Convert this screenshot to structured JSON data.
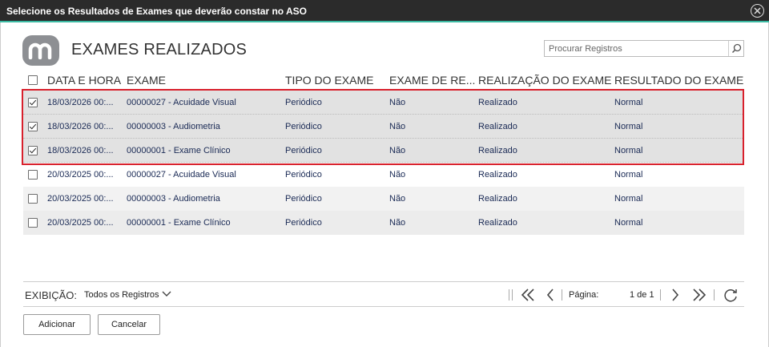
{
  "dialog": {
    "title": "Selecione os Resultados de Exames que deverão constar no ASO"
  },
  "page": {
    "heading": "EXAMES REALIZADOS"
  },
  "search": {
    "placeholder": "Procurar Registros"
  },
  "table": {
    "columns": [
      "DATA E HORA",
      "EXAME",
      "TIPO DO EXAME",
      "EXAME DE RE...",
      "REALIZAÇÃO DO EXAME",
      "RESULTADO DO EXAME"
    ],
    "rows": [
      {
        "checked": true,
        "date": "18/03/2026 00:...",
        "exam": "00000027 - Acuidade Visual",
        "type": "Periódico",
        "re": "Não",
        "realizacao": "Realizado",
        "resultado": "Normal"
      },
      {
        "checked": true,
        "date": "18/03/2026 00:...",
        "exam": "00000003 - Audiometria",
        "type": "Periódico",
        "re": "Não",
        "realizacao": "Realizado",
        "resultado": "Normal"
      },
      {
        "checked": true,
        "date": "18/03/2026 00:...",
        "exam": "00000001 - Exame Clínico",
        "type": "Periódico",
        "re": "Não",
        "realizacao": "Realizado",
        "resultado": "Normal"
      },
      {
        "checked": false,
        "date": "20/03/2025 00:...",
        "exam": "00000027 - Acuidade Visual",
        "type": "Periódico",
        "re": "Não",
        "realizacao": "Realizado",
        "resultado": "Normal"
      },
      {
        "checked": false,
        "date": "20/03/2025 00:...",
        "exam": "00000003 - Audiometria",
        "type": "Periódico",
        "re": "Não",
        "realizacao": "Realizado",
        "resultado": "Normal"
      },
      {
        "checked": false,
        "date": "20/03/2025 00:...",
        "exam": "00000001 - Exame Clínico",
        "type": "Periódico",
        "re": "Não",
        "realizacao": "Realizado",
        "resultado": "Normal"
      }
    ]
  },
  "footer": {
    "exibicao_label": "EXIBIÇÃO:",
    "exibicao_value": "Todos os Registros",
    "pagina_label": "Página:",
    "pagina_value": "1 de 1"
  },
  "buttons": {
    "add": "Adicionar",
    "cancel": "Cancelar"
  },
  "colors": {
    "titlebar": "#2b2b2b",
    "accent": "#3bb9a2",
    "selection_border": "#d8202c",
    "selected_row": "#e2e2e2"
  },
  "icons": [
    "close-icon",
    "logo-icon",
    "search-icon",
    "chevron-down-icon",
    "first-page-icon",
    "prev-page-icon",
    "next-page-icon",
    "last-page-icon",
    "refresh-icon"
  ]
}
